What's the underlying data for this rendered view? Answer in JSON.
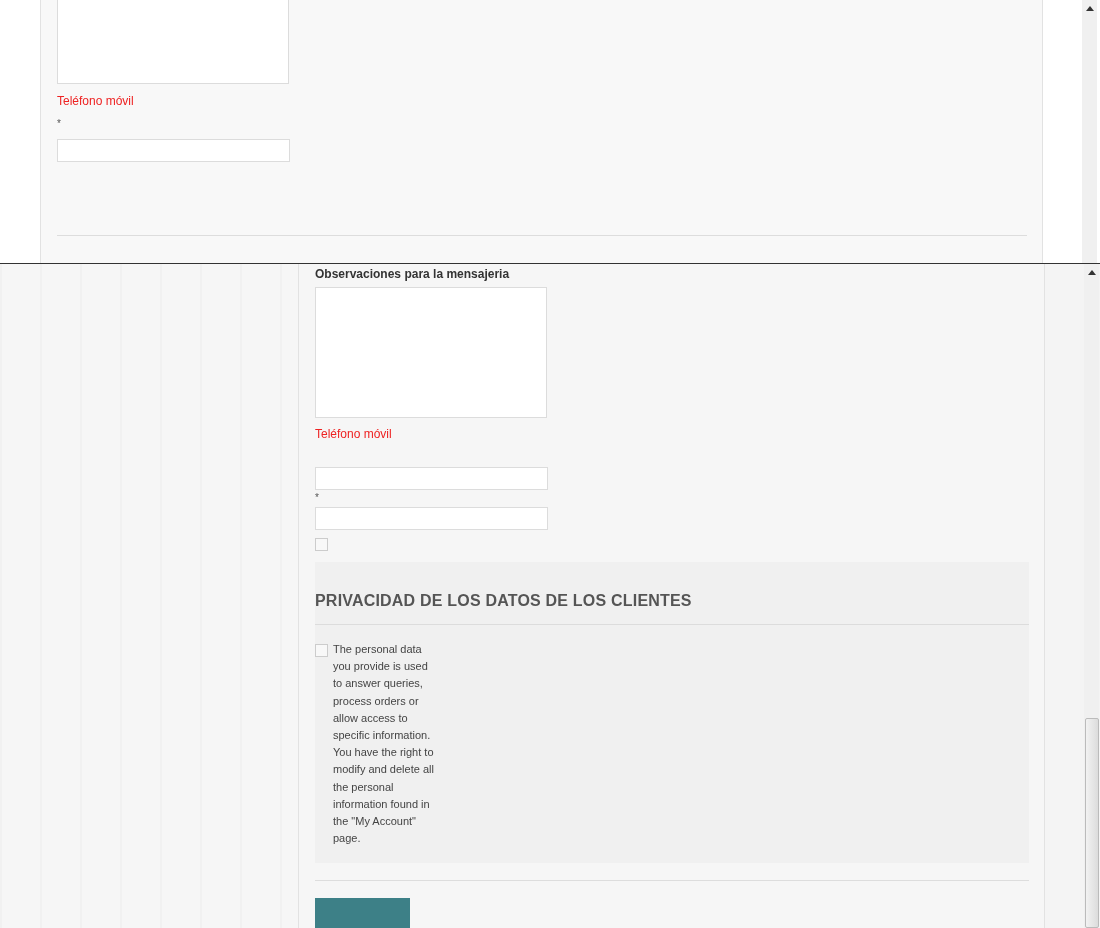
{
  "top_pane": {
    "phone_label": "Teléfono móvil",
    "required_mark": "*"
  },
  "bottom_pane": {
    "notes_label": "Observaciones para la mensajeria",
    "phone_label": "Teléfono móvil",
    "required_mark": "*",
    "extra_checkbox": {
      "checked": false
    },
    "privacy": {
      "title": "PRIVACIDAD DE LOS DATOS DE LOS CLIENTES",
      "consent": {
        "checked": false,
        "text": "The personal data you provide is used to answer queries, process orders or allow access to specific information. You have the right to modify and delete all the personal information found in the \"My Account\" page."
      }
    }
  }
}
